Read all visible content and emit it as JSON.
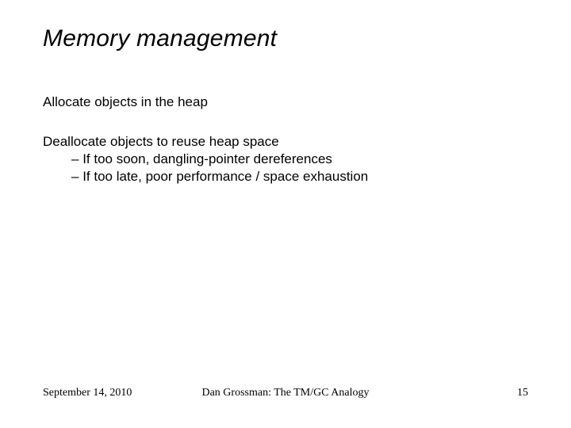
{
  "title": "Memory management",
  "body": {
    "p1": "Allocate objects in the heap",
    "p2": "Deallocate objects to reuse heap space",
    "p2_sub1": "If too soon, dangling-pointer dereferences",
    "p2_sub2": "If too late, poor performance / space exhaustion"
  },
  "footer": {
    "date": "September 14, 2010",
    "center": "Dan Grossman: The TM/GC Analogy",
    "page": "15"
  }
}
